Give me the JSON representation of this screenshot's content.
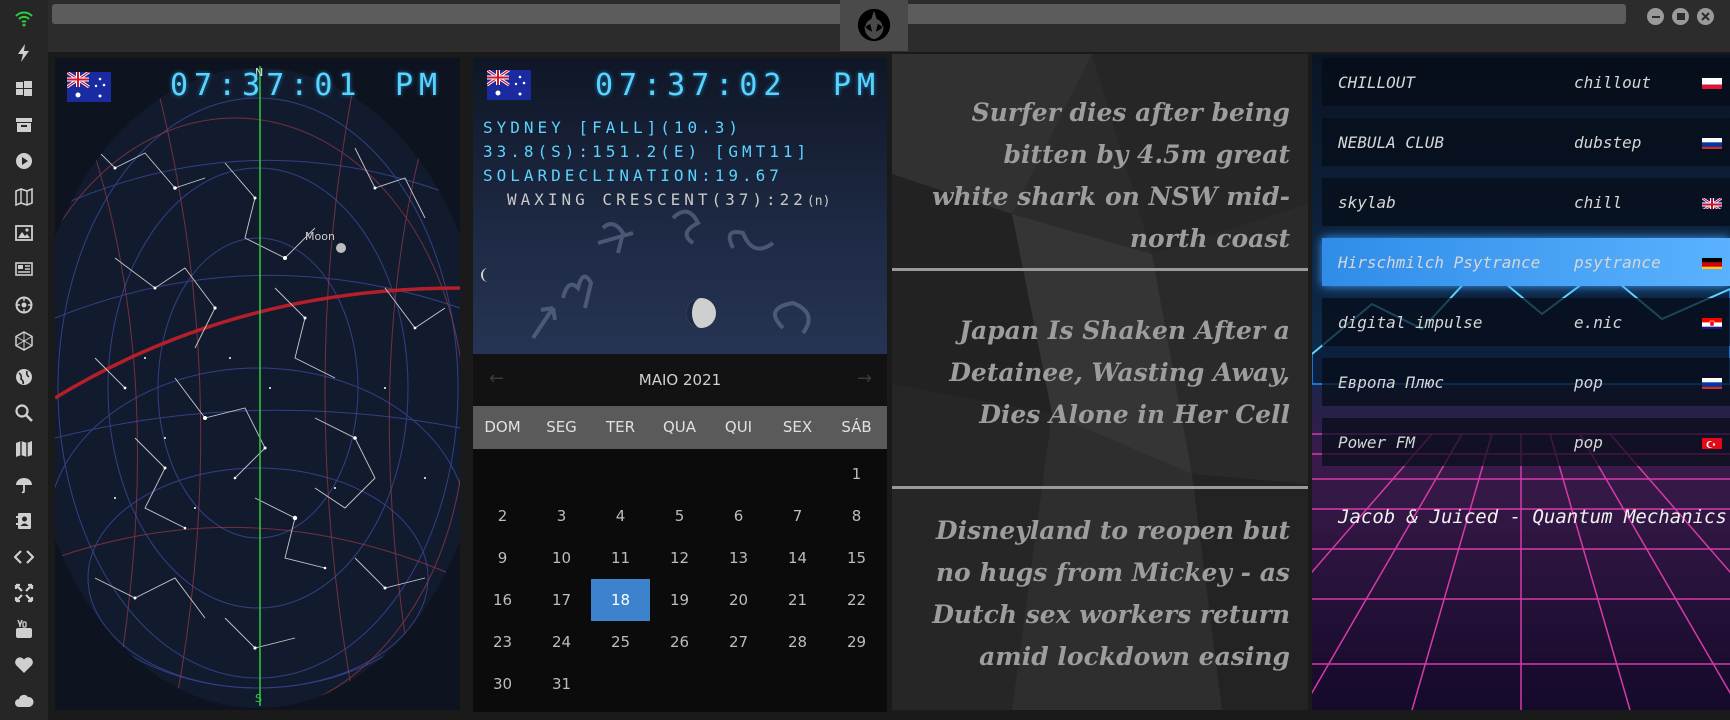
{
  "sidebar": {
    "icons": [
      "wifi-icon",
      "lightning-icon",
      "windows-icon",
      "archive-icon",
      "play-icon",
      "map-icon",
      "image-icon",
      "news-icon",
      "settings-icon",
      "hexagon-icon",
      "globe-icon",
      "search-icon",
      "map-fold-icon",
      "umbrella-icon",
      "contacts-icon",
      "code-icon",
      "fullscreen-icon",
      "youtube-icon",
      "heart-icon",
      "cloud-icon"
    ],
    "accent_color": "#2ecc40"
  },
  "window": {
    "logo": "rebel-alliance-logo-icon",
    "buttons": [
      "minimize-button",
      "maximize-button",
      "close-button"
    ]
  },
  "starmap": {
    "time": "07:37:01",
    "ampm": "PM",
    "north_label": "N",
    "south_label": "S",
    "moon_label": "Moon"
  },
  "info": {
    "time": "07:37:02",
    "ampm": "PM",
    "city_line": "SYDNEY [FALL](10.3)",
    "coords_line": "33.8(S):151.2(E) [GMT11]",
    "solar_line": "SOLARDECLINATION:19.67",
    "moon_phase": "WAXING CRESCENT(37):22",
    "moon_suffix": "(n)"
  },
  "calendar": {
    "month": "MAIO 2021",
    "prev_arrow": "←",
    "next_arrow": "→",
    "weekdays": [
      "DOM",
      "SEG",
      "TER",
      "QUA",
      "QUI",
      "SEX",
      "SÁB"
    ],
    "days": [
      "1",
      "2",
      "3",
      "4",
      "5",
      "6",
      "7",
      "8",
      "9",
      "10",
      "11",
      "12",
      "13",
      "14",
      "15",
      "16",
      "17",
      "18",
      "19",
      "20",
      "21",
      "22",
      "23",
      "24",
      "25",
      "26",
      "27",
      "28",
      "29",
      "30",
      "31"
    ],
    "selected_day": "18",
    "selected_color": "#3d82cc"
  },
  "news": {
    "items": [
      "Surfer dies after being bitten by 4.5m great white shark on NSW mid-north coast",
      "Japan Is Shaken After a Detainee, Wasting Away, Dies Alone in Her Cell",
      "Disneyland to reopen but no hugs from Mickey - as Dutch sex workers return amid lockdown easing"
    ]
  },
  "radio": {
    "stations": [
      {
        "name": "CHILLOUT",
        "genre": "chillout",
        "flag": "poland-flag-icon"
      },
      {
        "name": "NEBULA CLUB",
        "genre": "dubstep",
        "flag": "russia-flag-icon"
      },
      {
        "name": "skylab",
        "genre": "chill",
        "flag": "uk-flag-icon"
      },
      {
        "name": "Hirschmilch Psytrance",
        "genre": "psytrance",
        "flag": "germany-flag-icon"
      },
      {
        "name": "digital impulse",
        "genre": "e.nic",
        "flag": "croatia-flag-icon"
      },
      {
        "name": "Европа Плюс",
        "genre": "pop",
        "flag": "russia-flag-icon"
      },
      {
        "name": "Power FM",
        "genre": "pop",
        "flag": "turkey-flag-icon"
      }
    ],
    "selected_index": 3,
    "now_playing": "Jacob & Juiced - Quantum Mechanics"
  }
}
